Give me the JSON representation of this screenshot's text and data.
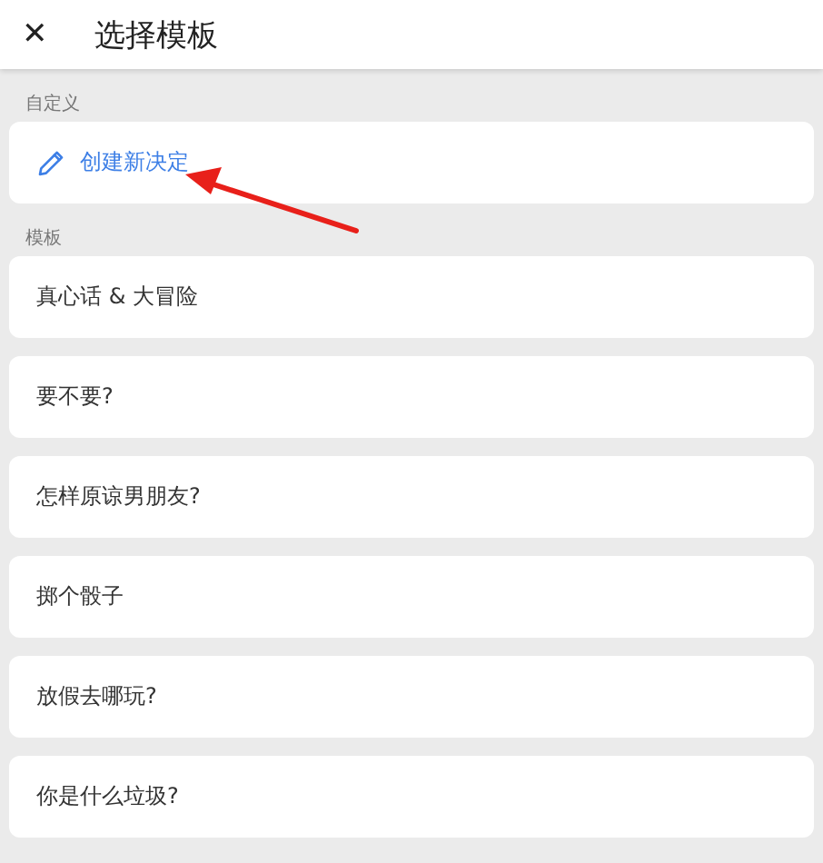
{
  "header": {
    "close_icon": "✕",
    "title": "选择模板"
  },
  "sections": [
    {
      "label": "自定义",
      "items": [
        {
          "kind": "create",
          "text": "创建新决定"
        }
      ]
    },
    {
      "label": "模板",
      "items": [
        {
          "kind": "template",
          "text": "真心话 & 大冒险"
        },
        {
          "kind": "template",
          "text": "要不要?"
        },
        {
          "kind": "template",
          "text": "怎样原谅男朋友?"
        },
        {
          "kind": "template",
          "text": "掷个骰子"
        },
        {
          "kind": "template",
          "text": "放假去哪玩?"
        },
        {
          "kind": "template",
          "text": "你是什么垃圾?"
        }
      ]
    }
  ]
}
